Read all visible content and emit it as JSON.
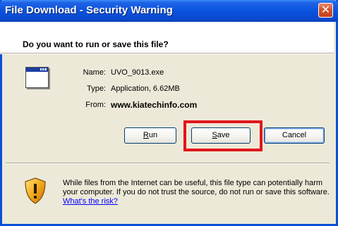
{
  "window": {
    "title": "File Download - Security Warning",
    "close_glyph": "✕"
  },
  "dialog": {
    "question": "Do you want to run or save this file?",
    "file": {
      "name_label": "Name:",
      "name_value": "UVO_9013.exe",
      "type_label": "Type:",
      "type_value": "Application, 6.62MB",
      "from_label": "From:",
      "from_value": "www.kiatechinfo.com"
    },
    "buttons": {
      "run_underlined": "R",
      "run_rest": "un",
      "save_underlined": "S",
      "save_rest": "ave",
      "cancel": "Cancel"
    },
    "warning": {
      "text": "While files from the Internet can be useful, this file type can potentially harm your computer. If you do not trust the source, do not run or save this software. ",
      "link": "What's the risk?"
    }
  },
  "icons": {
    "file": "application-window-icon",
    "shield": "security-shield-warning-icon"
  },
  "colors": {
    "titlebar": "#0a52df",
    "highlight": "#e2151b",
    "link": "#0000ff"
  }
}
